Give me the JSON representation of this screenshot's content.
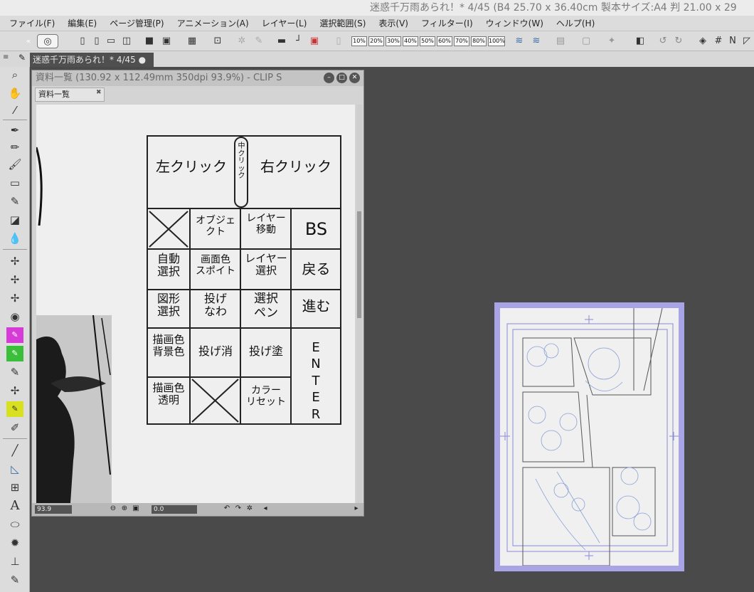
{
  "window": {
    "title": "迷惑千万雨あられ！* 4/45 (B4 25.70 x 36.40cm 製本サイズ:A4 判 21.00 x 29"
  },
  "menu": [
    "ファイル(F)",
    "編集(E)",
    "ページ管理(P)",
    "アニメーション(A)",
    "レイヤー(L)",
    "選択範囲(S)",
    "表示(V)",
    "フィルター(I)",
    "ウィンドウ(W)",
    "ヘルプ(H)"
  ],
  "toolbar": {
    "zoom_presets": [
      "10%",
      "20%",
      "30%",
      "40%",
      "50%",
      "60%",
      "70%",
      "80%",
      "100%"
    ]
  },
  "document_tab": {
    "label": "迷惑千万雨あられ！* 4/45 ●"
  },
  "panel": {
    "title": "資料一覧 (130.92 x 112.49mm 350dpi 93.9%)  - CLIP S",
    "tab": "資料一覧",
    "zoom_value": "93.9",
    "rotate_value": "0.0"
  },
  "sheet": {
    "top": {
      "left": "左クリック",
      "middle": "中クリック",
      "right": "右クリック"
    },
    "rows": [
      [
        "",
        "オブジェ\nクト",
        "レイヤー\n移動",
        "BS"
      ],
      [
        "自動\n選択",
        "画面色\nスポイト",
        "レイヤー\n選択",
        "戻る"
      ],
      [
        "図形\n選択",
        "投げ\nなわ",
        "選択\nペン",
        "進む"
      ],
      [
        "描画色\n背景色",
        "投げ消",
        "投げ塗",
        "ENTER"
      ],
      [
        "描画色\n透明",
        "",
        "カラー\nリセット",
        ""
      ]
    ]
  },
  "colors": {
    "navigator_frame": "#a8a4e6",
    "accent_purple": "#d73bd7",
    "accent_green": "#3bbf3b",
    "accent_yellow": "#d8e020"
  }
}
